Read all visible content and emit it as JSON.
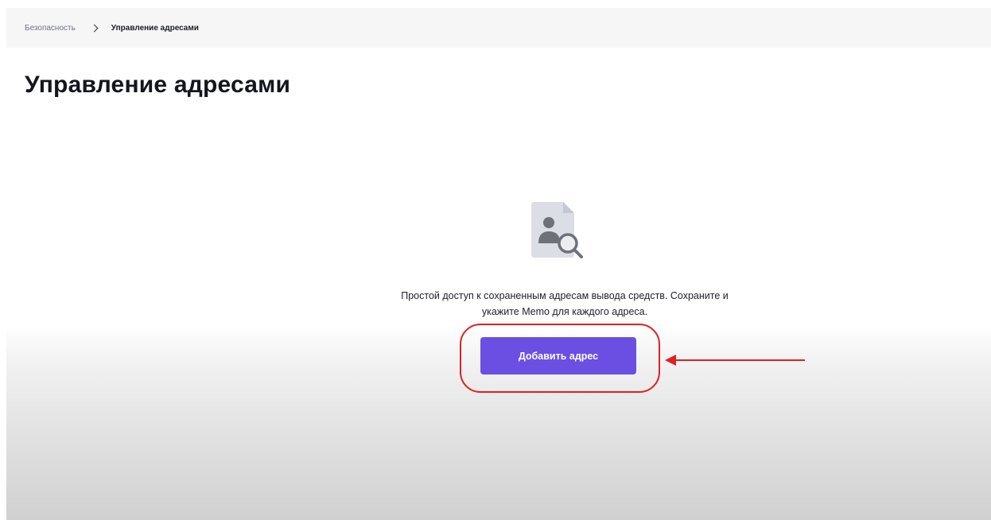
{
  "breadcrumb": {
    "parent": "Безопасность",
    "current": "Управление адресами"
  },
  "page": {
    "title": "Управление адресами"
  },
  "empty_state": {
    "icon": "address-book-search-icon",
    "description_line1": "Простой доступ к сохраненным адресам вывода средств. Сохраните и",
    "description_line2": "укажите Memo для каждого адреса.",
    "button_label": "Добавить адрес"
  },
  "annotation": {
    "highlight_color": "#e02020",
    "accent_color": "#6a4fe2"
  }
}
